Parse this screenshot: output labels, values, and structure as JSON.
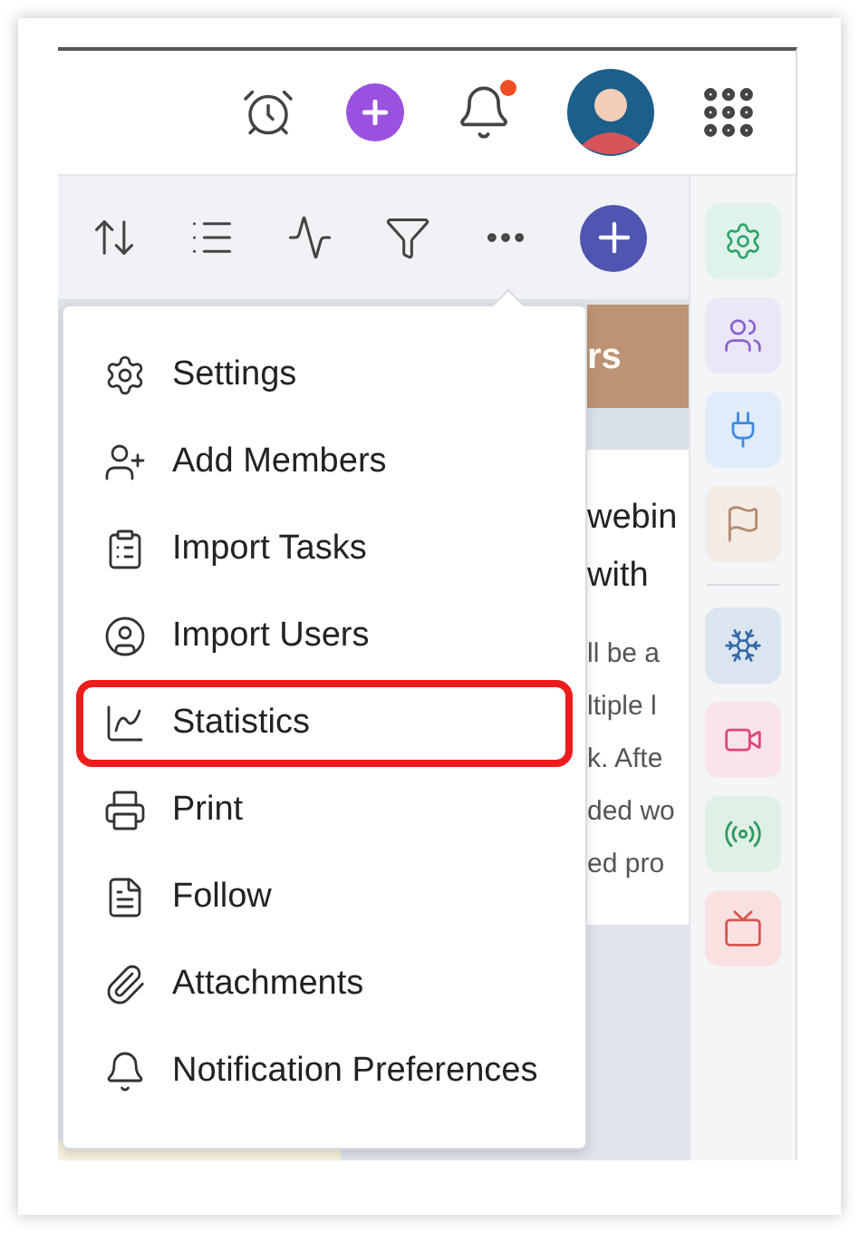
{
  "top_bar": {
    "notifications_unread": true
  },
  "menu": {
    "items": [
      {
        "label": "Settings",
        "highlighted": false
      },
      {
        "label": "Add Members",
        "highlighted": false
      },
      {
        "label": "Import Tasks",
        "highlighted": false
      },
      {
        "label": "Import Users",
        "highlighted": false
      },
      {
        "label": "Statistics",
        "highlighted": true
      },
      {
        "label": "Print",
        "highlighted": false
      },
      {
        "label": "Follow",
        "highlighted": false
      },
      {
        "label": "Attachments",
        "highlighted": false
      },
      {
        "label": "Notification Preferences",
        "highlighted": false
      }
    ]
  },
  "background_card": {
    "header": "rs",
    "title_lines": [
      "webin",
      "with"
    ],
    "body_lines": [
      "ll be a",
      "ltiple l",
      "k. Afte",
      "ded wo",
      "ed pro"
    ]
  }
}
